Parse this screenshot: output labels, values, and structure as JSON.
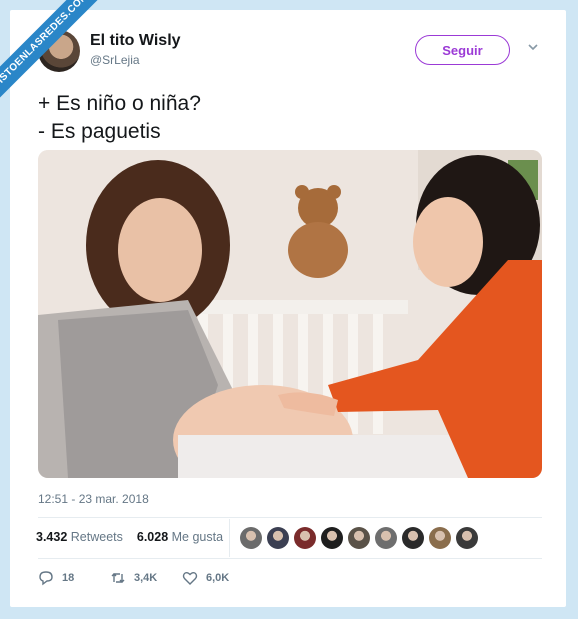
{
  "watermark": {
    "text": "VISTOENLASREDES.COM"
  },
  "tweet": {
    "author_name": "El tito Wisly",
    "author_handle": "@SrLejia",
    "follow_label": "Seguir",
    "lines": [
      "+ Es niño o niña?",
      "- Es paguetis"
    ],
    "timestamp": "12:51 - 23 mar. 2018",
    "retweets_count": "3.432",
    "retweets_label": "Retweets",
    "likes_count": "6.028",
    "likes_label": "Me gusta",
    "reply_count": "18",
    "retweet_count_short": "3,4K",
    "like_count_short": "6,0K"
  },
  "colors": {
    "accent": "#9b3ad6",
    "ribbon": "#2a86c8",
    "background": "#cfe6f4"
  },
  "liker_avatars": [
    {
      "color": "#6b6b6b"
    },
    {
      "color": "#3b3f52"
    },
    {
      "color": "#7a2b2b"
    },
    {
      "color": "#1e1e1e"
    },
    {
      "color": "#5a5248"
    },
    {
      "color": "#6e6e6e"
    },
    {
      "color": "#2a2a2a"
    },
    {
      "color": "#8a6d4c"
    },
    {
      "color": "#3a3a3a"
    }
  ]
}
